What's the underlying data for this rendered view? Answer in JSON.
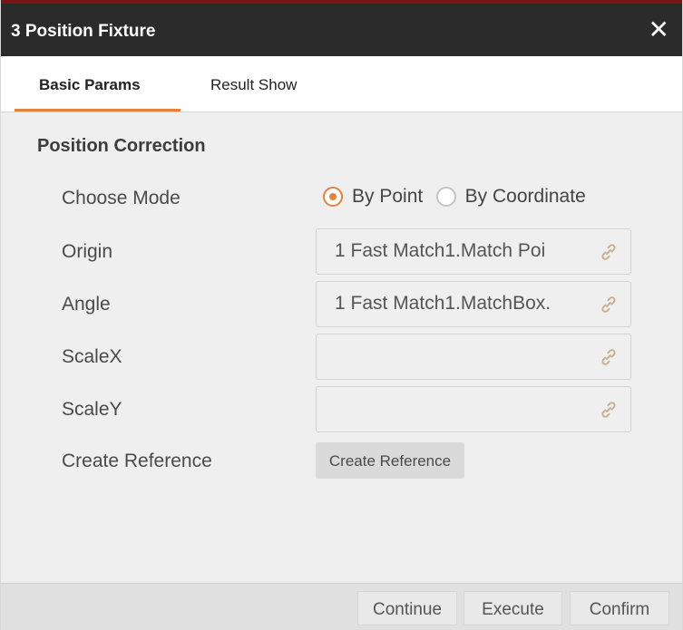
{
  "window": {
    "title": "3 Position Fixture",
    "close_icon": "close-icon"
  },
  "tabs": [
    {
      "label": "Basic Params",
      "active": true
    },
    {
      "label": "Result Show",
      "active": false
    }
  ],
  "section": {
    "title": "Position Correction"
  },
  "form": {
    "choose_mode": {
      "label": "Choose Mode",
      "options": [
        {
          "label": "By Point",
          "selected": true
        },
        {
          "label": "By Coordinate",
          "selected": false
        }
      ]
    },
    "origin": {
      "label": "Origin",
      "value": "1 Fast Match1.Match Poi"
    },
    "angle": {
      "label": "Angle",
      "value": "1 Fast Match1.MatchBox."
    },
    "scalex": {
      "label": "ScaleX",
      "value": ""
    },
    "scaley": {
      "label": "ScaleY",
      "value": ""
    },
    "create_reference": {
      "label": "Create Reference",
      "button_label": "Create Reference"
    }
  },
  "footer": {
    "continue_label": "Continue",
    "execute_label": "Execute",
    "confirm_label": "Confirm"
  },
  "colors": {
    "accent": "#e8823a",
    "titlebar": "#2b2b2b",
    "link_icon": "#c9b08f"
  }
}
